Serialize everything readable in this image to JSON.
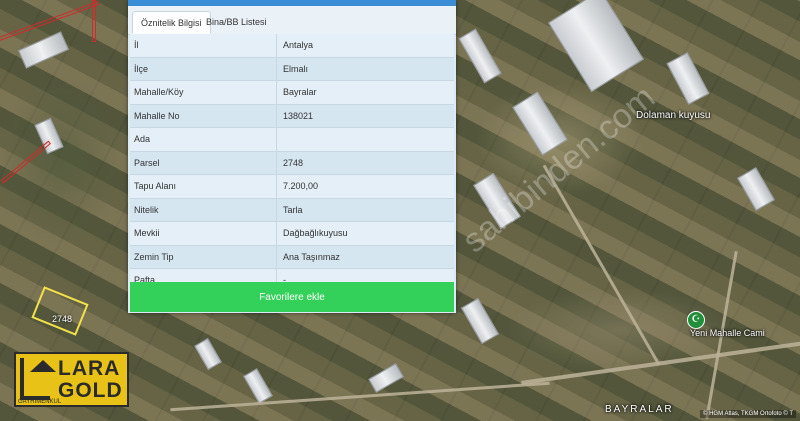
{
  "tabs": [
    {
      "label": "Öznitelik Bilgisi",
      "active": true
    },
    {
      "label": "Bina/BB Listesi",
      "active": false
    }
  ],
  "rows": [
    {
      "key": "İl",
      "value": "Antalya"
    },
    {
      "key": "İlçe",
      "value": "Elmalı"
    },
    {
      "key": "Mahalle/Köy",
      "value": "Bayralar"
    },
    {
      "key": "Mahalle No",
      "value": "138021"
    },
    {
      "key": "Ada",
      "value": ""
    },
    {
      "key": "Parsel",
      "value": "2748"
    },
    {
      "key": "Tapu Alanı",
      "value": "7.200,00"
    },
    {
      "key": "Nitelik",
      "value": "Tarla"
    },
    {
      "key": "Mevkii",
      "value": "Dağbağlıkuyusu"
    },
    {
      "key": "Zemin Tip",
      "value": "Ana Taşınmaz"
    },
    {
      "key": "Pafta",
      "value": "-"
    }
  ],
  "favorite_button": "Favorilere ekle",
  "map": {
    "labels": {
      "doloman": "Dolaman kuyusu",
      "mosque": "Yeni Mahalle Cami",
      "village": "BAYRALAR",
      "parcel": "2748"
    },
    "watermark": "sahibinden.com",
    "attribution": "© HGM Atlas, TKGM Ortofoto © T"
  },
  "logo": {
    "line1": "LARA",
    "line2": "GOLD",
    "sub": "GAYRIMENKUL"
  },
  "colors": {
    "accent": "#3b8ed6",
    "button": "#33d15a",
    "logo": "#e8c217",
    "parcel_outline": "#f2e04a",
    "boundary": "#d12a2a"
  }
}
